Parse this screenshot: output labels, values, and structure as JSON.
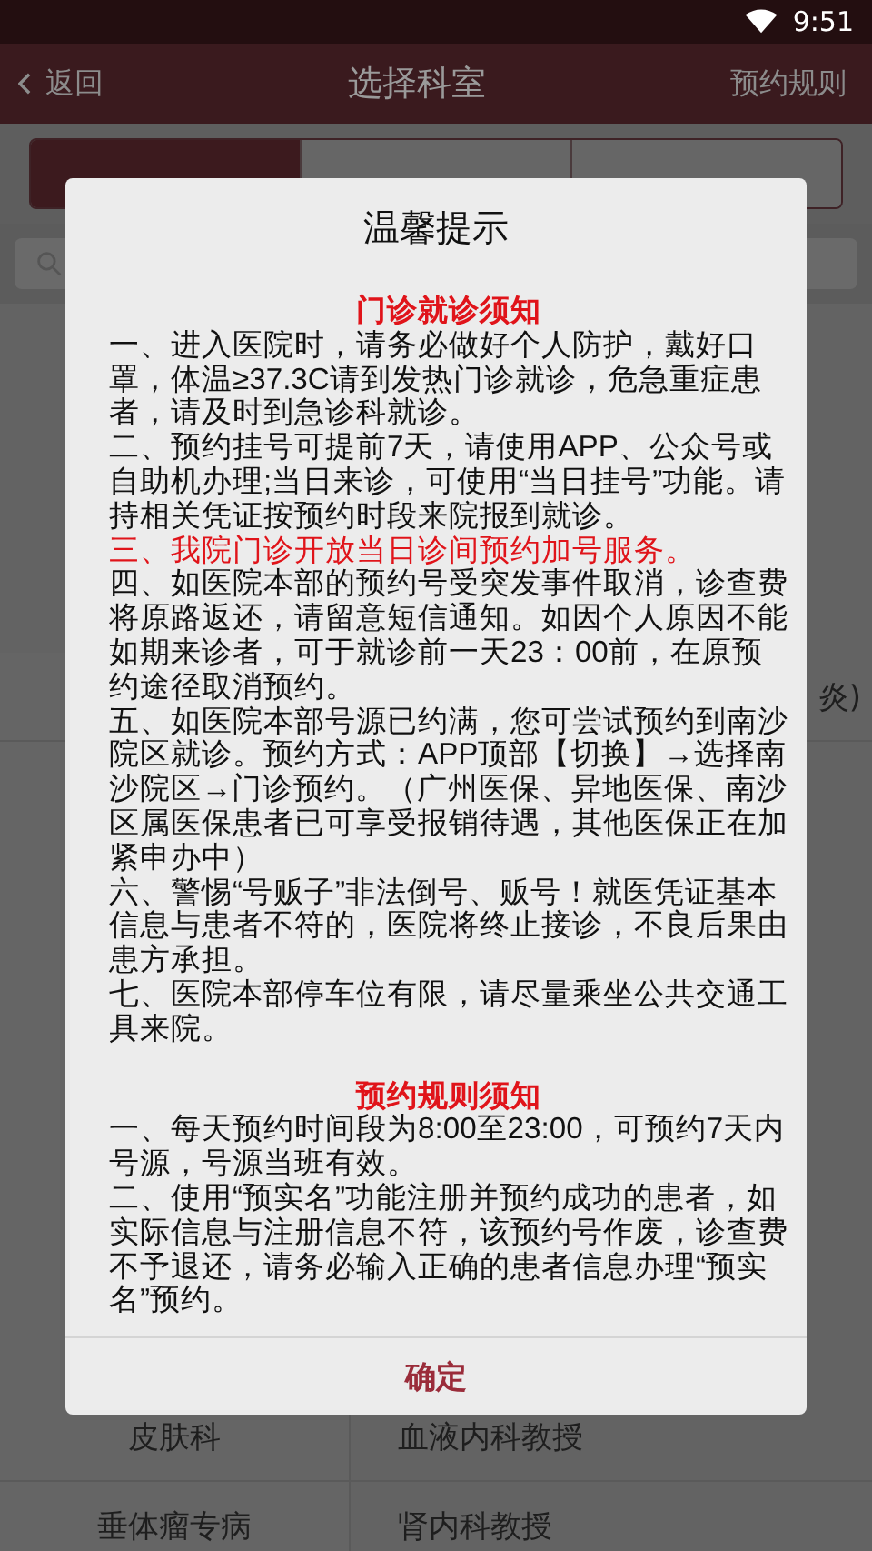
{
  "status_bar": {
    "time": "9:51"
  },
  "nav": {
    "back": "返回",
    "title": "选择科室",
    "action": "预约规则"
  },
  "tabs": [
    {
      "selected": true
    },
    {
      "selected": false
    },
    {
      "selected": false
    }
  ],
  "list": {
    "top_rows": [
      {
        "department": "",
        "doctor": "炎)"
      }
    ],
    "bottom_rows": [
      {
        "department": "皮肤科",
        "doctor": "血液内科教授"
      },
      {
        "department": "垂体瘤专病",
        "doctor": "肾内科教授"
      }
    ]
  },
  "dialog": {
    "title": "温馨提示",
    "paragraphs": [
      {
        "kind": "heading",
        "text": "门诊就诊须知"
      },
      {
        "kind": "text",
        "text": "一、进入医院时，请务必做好个人防护，戴好口罩，体温≥37.3C请到发热门诊就诊，危急重症患者，请及时到急诊科就诊。"
      },
      {
        "kind": "text",
        "text": "二、预约挂号可提前7天，请使用APP、公众号或自助机办理;当日来诊，可使用“当日挂号”功能。请持相关凭证按预约时段来院报到就诊。"
      },
      {
        "kind": "highlight",
        "text": "三、我院门诊开放当日诊间预约加号服务。"
      },
      {
        "kind": "text",
        "text": "四、如医院本部的预约号受突发事件取消，诊查费将原路返还，请留意短信通知。如因个人原因不能如期来诊者，可于就诊前一天23：00前，在原预约途径取消预约。"
      },
      {
        "kind": "text",
        "text": "五、如医院本部号源已约满，您可尝试预约到南沙院区就诊。预约方式：APP顶部【切换】→选择南沙院区→门诊预约。（广州医保、异地医保、南沙区属医保患者已可享受报销待遇，其他医保正在加紧申办中）"
      },
      {
        "kind": "text",
        "text": "六、警惕“号贩子”非法倒号、贩号！就医凭证基本信息与患者不符的，医院将终止接诊，不良后果由患方承担。"
      },
      {
        "kind": "text",
        "text": "七、医院本部停车位有限，请尽量乘坐公共交通工具来院。"
      },
      {
        "kind": "heading",
        "text": "预约规则须知"
      },
      {
        "kind": "text",
        "text": "一、每天预约时间段为8:00至23:00，可预约7天内号源，号源当班有效。"
      },
      {
        "kind": "text",
        "text": "二、使用“预实名”功能注册并预约成功的患者，如实际信息与注册信息不符，该预约号作废，诊查费不予退还，请务必输入正确的患者信息办理“预实名”预约。"
      }
    ],
    "confirm": "确定"
  }
}
